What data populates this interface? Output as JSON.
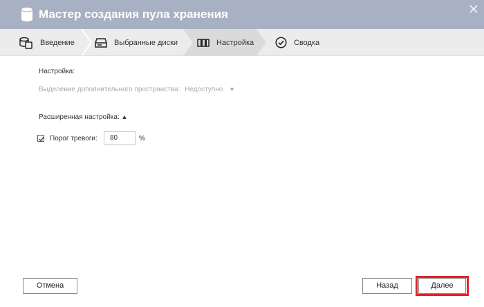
{
  "window": {
    "title": "Мастер создания пула хранения",
    "title_icon": "storage-cylinder-icon",
    "close_icon": "close-icon",
    "titlebar_color": "#a8b0c4"
  },
  "steps": [
    {
      "label": "Введение",
      "icon": "database-icon",
      "active": false
    },
    {
      "label": "Выбранные диски",
      "icon": "disk-drive-icon",
      "active": false
    },
    {
      "label": "Настройка",
      "icon": "settings-bars-icon",
      "active": true
    },
    {
      "label": "Сводка",
      "icon": "checkmark-circle-icon",
      "active": false
    }
  ],
  "config": {
    "heading": "Настройка:",
    "extra_space_label": "Выделение дополнительного пространства:",
    "extra_space_value": "Недоступно",
    "advanced_heading": "Расширенная настройка:",
    "advanced_toggle": "▲",
    "alarm_checked": true,
    "alarm_label": "Порог тревоги:",
    "alarm_value": "80",
    "alarm_unit": "%"
  },
  "footer": {
    "cancel_label": "Отмена",
    "back_label": "Назад",
    "next_label": "Далее",
    "highlight_color": "#e3202a"
  }
}
